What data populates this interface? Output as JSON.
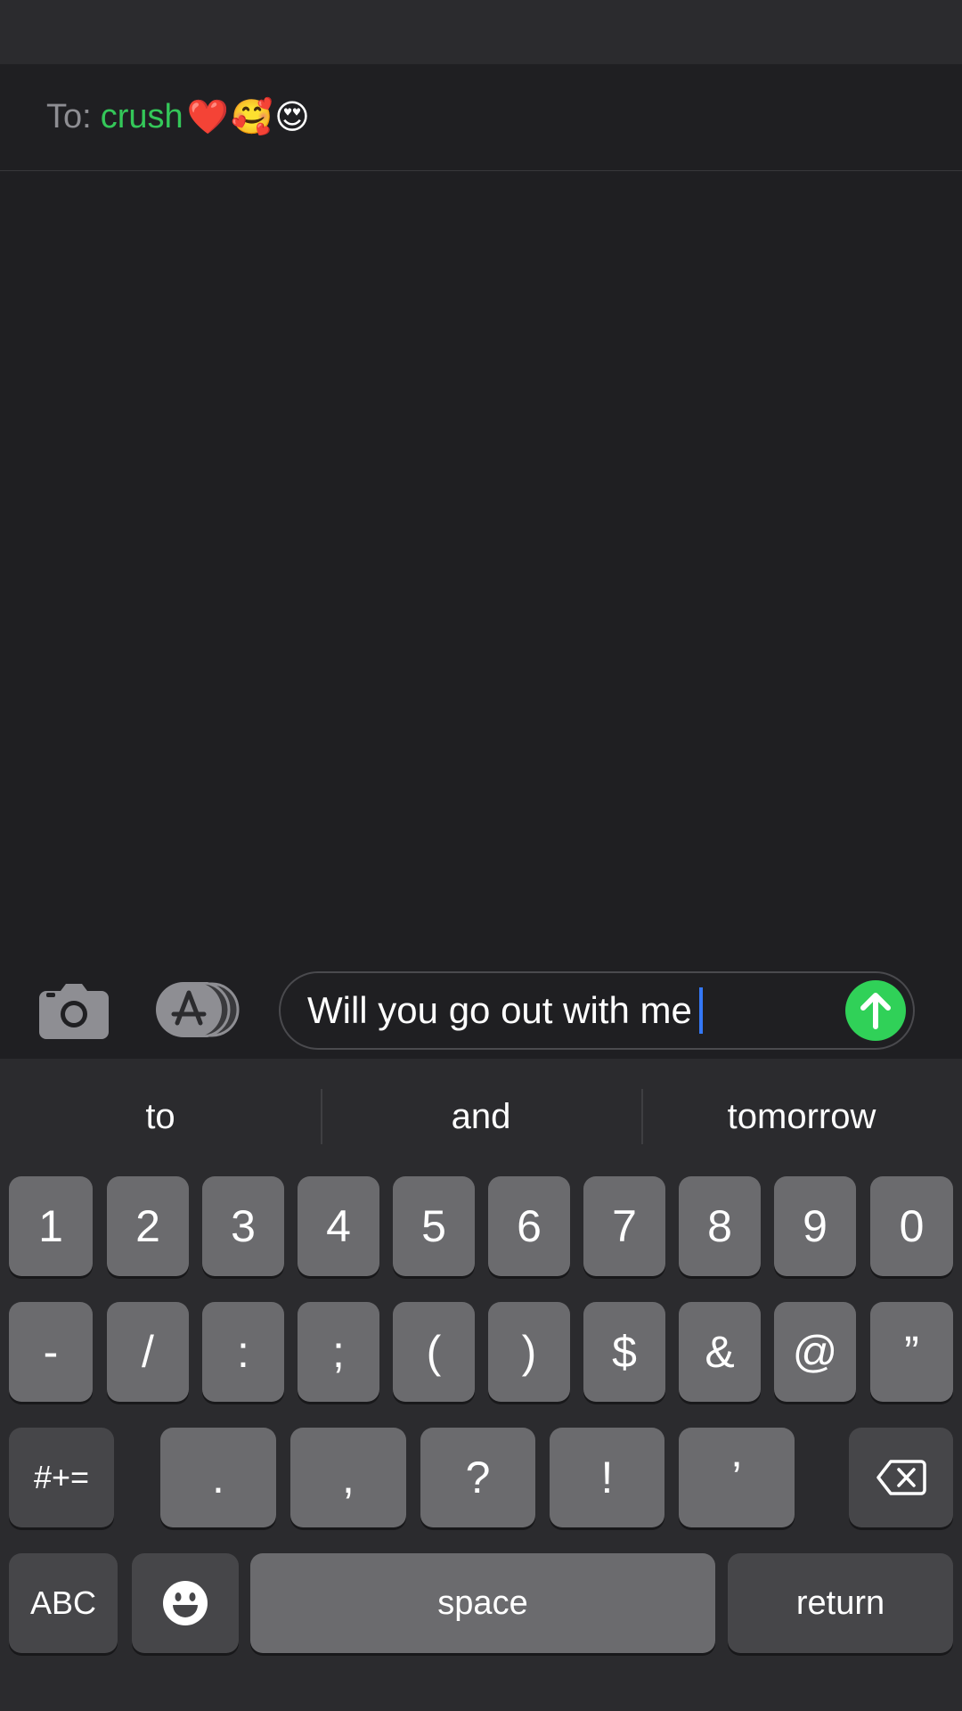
{
  "header": {
    "to_label": "To:",
    "recipient": "crush",
    "recipient_emojis": "❤️🥰😍"
  },
  "compose": {
    "camera_icon": "camera-icon",
    "apps_icon": "app-store-icon",
    "message_text": "Will you go out with me",
    "send_icon": "arrow-up-icon",
    "send_color": "#30d158"
  },
  "suggestions": [
    "to",
    "and",
    "tomorrow"
  ],
  "keyboard": {
    "row1": [
      "1",
      "2",
      "3",
      "4",
      "5",
      "6",
      "7",
      "8",
      "9",
      "0"
    ],
    "row2": [
      "-",
      "/",
      ":",
      ";",
      "(",
      ")",
      "$",
      "&",
      "@",
      "”"
    ],
    "row3": [
      ".",
      ",",
      "?",
      "!",
      "’"
    ],
    "symbols_key": "#+=",
    "delete_icon": "backspace-icon",
    "abc_key": "ABC",
    "emoji_icon": "emoji-icon",
    "space_key": "space",
    "return_key": "return"
  }
}
